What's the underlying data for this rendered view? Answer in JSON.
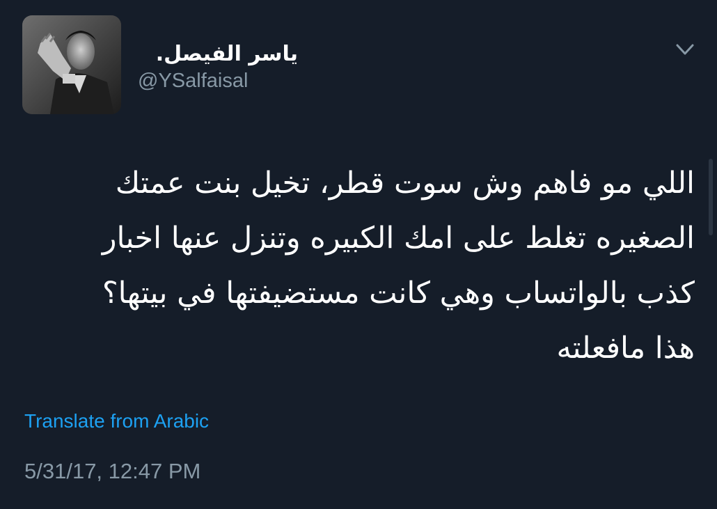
{
  "author": {
    "display_name": "ياسر الفيصل.",
    "handle": "@YSalfaisal",
    "avatar_icon": "profile-photo"
  },
  "tweet": {
    "lines": [
      "اللي مو فاهم وش سوت قطر، تخيل بنت عمتك",
      "الصغيره تغلط على امك الكبيره وتنزل عنها اخبار",
      "كذب بالواتساب وهي كانت مستضيفتها في بيتها؟",
      "هذا مافعلته"
    ],
    "translate_label": "Translate from Arabic",
    "timestamp": "5/31/17, 12:47 PM"
  },
  "menu": {
    "icon": "chevron-down-icon"
  },
  "colors": {
    "background": "#151d29",
    "text": "#ffffff",
    "secondary_text": "#8899a6",
    "link": "#1da1f2"
  }
}
